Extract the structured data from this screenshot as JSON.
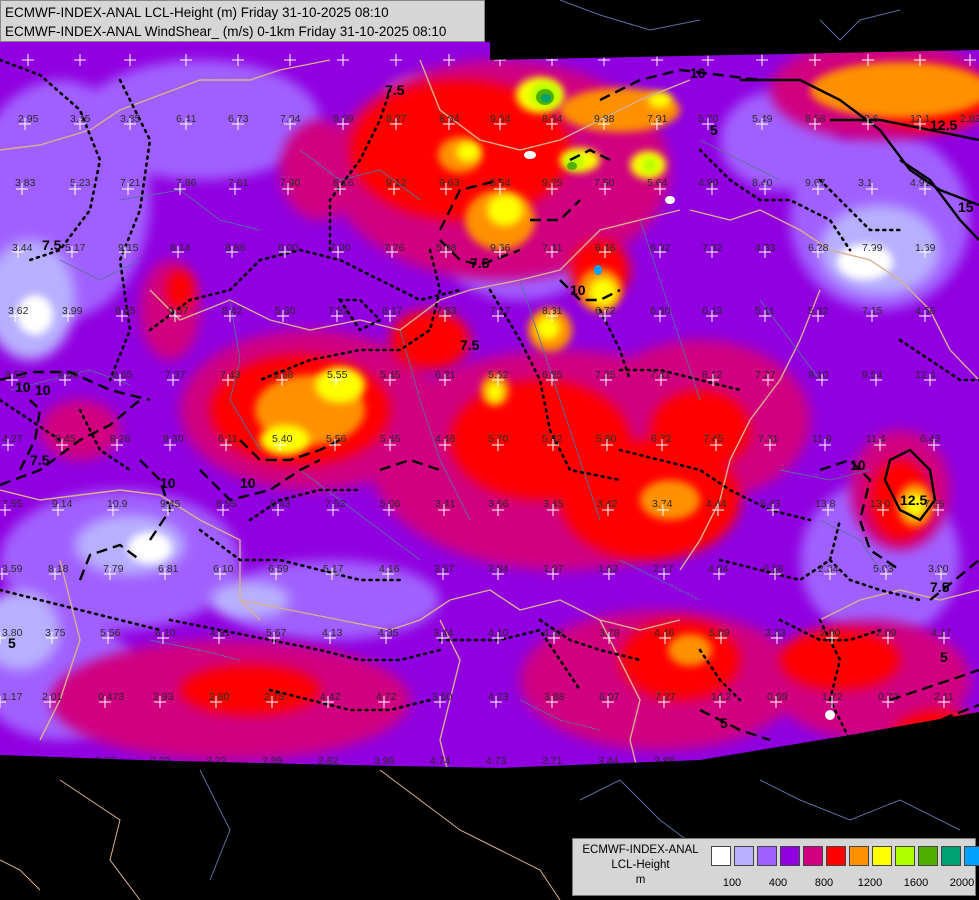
{
  "header": {
    "line1": "ECMWF-INDEX-ANAL LCL-Height (m) Friday 31-10-2025 08:10",
    "line2": "ECMWF-INDEX-ANAL WindShear_ (m/s) 0-1km Friday 31-10-2025 08:10"
  },
  "legend": {
    "line1": "ECMWF-INDEX-ANAL",
    "line2": "LCL-Height",
    "line3": "m",
    "colors": [
      "#ffffff",
      "#b8b0ff",
      "#a060ff",
      "#9000e0",
      "#d00080",
      "#ff0000",
      "#ff9000",
      "#ffff00",
      "#b0ff00",
      "#50b000",
      "#00a070",
      "#00a0ff"
    ],
    "ticks": [
      "100",
      "400",
      "800",
      "1200",
      "1600",
      "2000"
    ]
  },
  "palette": {
    "no_data": "#000000",
    "base": "#9000e0",
    "light_purple": "#b8b0ff",
    "mid_purple": "#a060ff",
    "magenta": "#d00080",
    "red": "#ff0000",
    "orange": "#ff9000",
    "yellow": "#ffff00",
    "lime": "#b0ff00",
    "green": "#50b000",
    "teal": "#00a070",
    "cyan": "#00a0ff",
    "white": "#ffffff",
    "border_country": "#d8b090",
    "border_region": "#5a6ea0",
    "isoline": "#000000"
  },
  "isoline_labels": [
    "10",
    "10",
    "7.5",
    "7.5",
    "10",
    "7.5",
    "5",
    "12.5",
    "15",
    "12.5",
    "10",
    "10",
    "7.5",
    "7.5",
    "5",
    "5",
    "5",
    "10",
    "7.5",
    "10"
  ],
  "values": [
    "2.95",
    "3.45",
    "3.85",
    "6.41",
    "6.73",
    "7.04",
    "9.09",
    "8.27",
    "8.84",
    "9.64",
    "8.64",
    "9.88",
    "7.91",
    "5.70",
    "5.49",
    "8.58",
    "12.6",
    "12.1",
    "2.82",
    "3.83",
    "5.23",
    "7.21",
    "7.86",
    "7.61",
    "7.90",
    "8.16",
    "9.12",
    "9.63",
    "8.54",
    "9.25",
    "7.50",
    "5.64",
    "4.90",
    "8.40",
    "9.67",
    "3.1",
    "4.91",
    "3.44",
    "5.17",
    "9.15",
    "8.14",
    "8.86",
    "6.00",
    "7.00",
    "7.76",
    "5.98",
    "9.66",
    "7.41",
    "6.46",
    "6.92",
    "7.82",
    "4.33",
    "6.28",
    "7.99",
    "1.69",
    "3.62",
    "3.99",
    "8.65",
    "9.57",
    "8.42",
    "5.30",
    "7.52",
    "8.17",
    "7.83",
    "7.17",
    "8.31",
    "6.72",
    "6.60",
    "6.43",
    "5.11",
    "5.32",
    "7.15",
    "4.66",
    "9.55",
    "8.53",
    "8.65",
    "7.37",
    "7.43",
    "5.68",
    "5.55",
    "5.45",
    "6.21",
    "5.62",
    "6.85",
    "7.25",
    "7.41",
    "8.12",
    "7.27",
    "9.10",
    "9.54",
    "12.4",
    "4.27",
    "8.45",
    "8.26",
    "9.30",
    "6.11",
    "5.40",
    "5.56",
    "5.45",
    "4.46",
    "5.70",
    "5.42",
    "5.80",
    "6.72",
    "7.45",
    "7.31",
    "11.9",
    "11.4",
    "6.43",
    "7.55",
    "9.14",
    "10.9",
    "9.45",
    "8.55",
    "8.43",
    "7.52",
    "5.06",
    "3.41",
    "3.66",
    "3.45",
    "3.42",
    "3.74",
    "4.44",
    "5.43",
    "13.8",
    "13.0",
    "7.55",
    "3.59",
    "8.18",
    "7.79",
    "6.81",
    "6.10",
    "6.59",
    "5.17",
    "4.16",
    "3.57",
    "2.84",
    "1.97",
    "1.62",
    "2.17",
    "4.94",
    "6.58",
    "2.34",
    "5.03",
    "3.90",
    "3.80",
    "3.75",
    "5.56",
    "6.10",
    "4.91",
    "5.67",
    "4.13",
    "4.35",
    "3.44",
    "4.10",
    "4.13",
    "3.78",
    "4.46",
    "5.89",
    "3.33",
    "2.90",
    "2.09",
    "4.17",
    "1.17",
    "2.01",
    "0.473",
    "2.93",
    "2.80",
    "2.75",
    "4.42",
    "4.72",
    "3.50",
    "4.23",
    "3.88",
    "6.07",
    "7.27",
    "14.2",
    "0.69",
    "1.72",
    "0.72",
    "2.11",
    "2.49",
    "3.23",
    "3.03",
    "3.22",
    "3.22",
    "2.89",
    "2.82",
    "3.98",
    "4.74",
    "4.73",
    "3.71",
    "3.44",
    "3.88"
  ],
  "grid_crosses_visible": true
}
